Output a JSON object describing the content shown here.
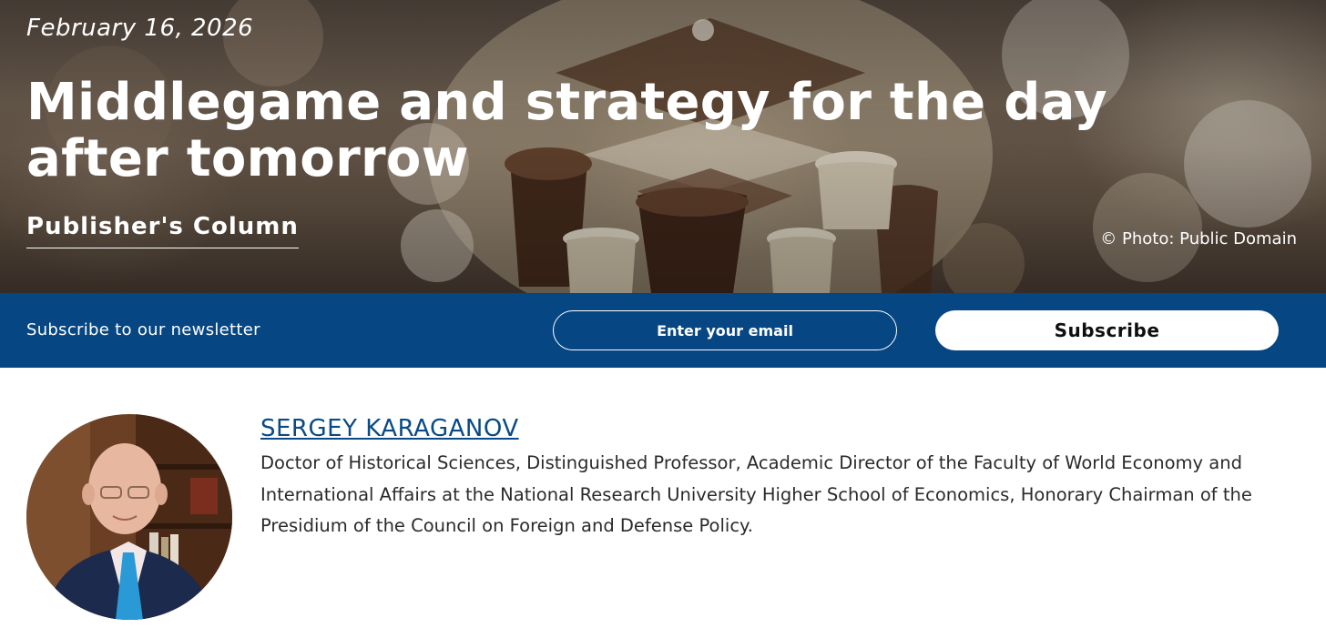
{
  "hero": {
    "date": "February 16, 2026",
    "title": "Middlegame and strategy for the day after tomorrow",
    "category": "Publisher's Column",
    "photo_credit": "© Photo: Public Domain"
  },
  "newsletter": {
    "label": "Subscribe to our newsletter",
    "email_placeholder": "Enter your email",
    "subscribe_label": "Subscribe"
  },
  "author": {
    "name": "SERGEY KARAGANOV",
    "bio": "Doctor of Historical Sciences, Distinguished Professor, Academic Director of the Faculty of World Economy and International Affairs at the National Research University Higher School of Economics, Honorary Chairman of the Presidium of the Council on Foreign and Defense Policy."
  },
  "colors": {
    "newsletter_bar": "#064683",
    "author_link": "#0a4a85",
    "body_text": "#2a2a2a"
  }
}
